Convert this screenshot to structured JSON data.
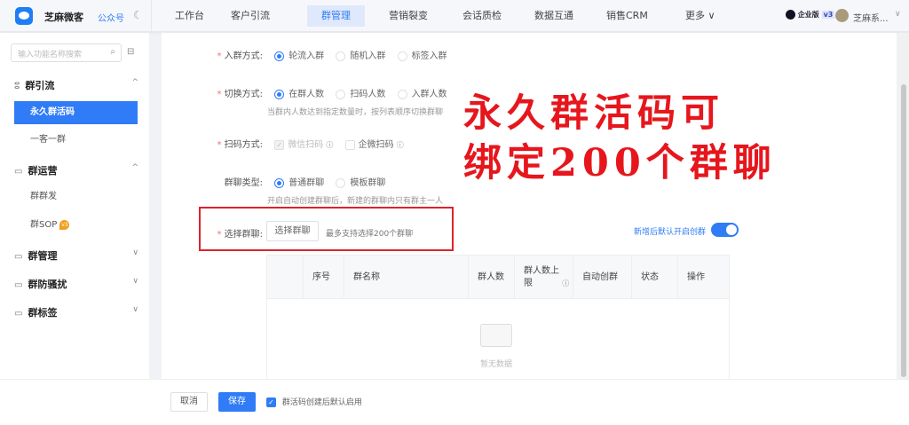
{
  "header": {
    "brand": "芝麻微客",
    "gzh": "公众号",
    "nav": [
      "工作台",
      "客户引流",
      "群管理",
      "营销裂变",
      "会话质检",
      "数据互通",
      "销售CRM",
      "更多 ∨"
    ],
    "active_nav": "群管理",
    "edition": "企业版",
    "version": "v3",
    "user": "芝麻系...",
    "chevron": "∨"
  },
  "sidebar": {
    "search_placeholder": "输入功能名称搜索",
    "groups": [
      {
        "label": "群引流",
        "chev": "^",
        "items": [
          "永久群活码",
          "一客一群"
        ]
      },
      {
        "label": "群运营",
        "chev": "^",
        "items": [
          "群群发",
          "群SOP"
        ]
      },
      {
        "label": "群管理",
        "chev": "∨"
      },
      {
        "label": "群防骚扰",
        "chev": "∨"
      },
      {
        "label": "群标签",
        "chev": "∨"
      }
    ],
    "sop_badge": "v3"
  },
  "form": {
    "join": {
      "label": "入群方式:",
      "options": [
        "轮流入群",
        "随机入群",
        "标签入群"
      ],
      "selected": "轮流入群"
    },
    "switch": {
      "label": "切换方式:",
      "options": [
        "在群人数",
        "扫码人数",
        "入群人数"
      ],
      "selected": "在群人数",
      "hint": "当群内人数达到指定数量时，按列表顺序切换群聊"
    },
    "scan": {
      "label": "扫码方式:",
      "options": [
        "微信扫码",
        "企微扫码"
      ],
      "checked": "微信扫码"
    },
    "type": {
      "label": "群聊类型:",
      "options": [
        "普通群聊",
        "模板群聊"
      ],
      "selected": "普通群聊",
      "hint": "开启自动创建群聊后，新建的群聊内只有群主一人"
    },
    "select": {
      "label": "选择群聊:",
      "button": "选择群聊",
      "hint": "最多支持选择200个群聊"
    },
    "auto_toggle": {
      "label": "新增后默认开启创群",
      "on": true
    }
  },
  "table": {
    "columns": [
      "序号",
      "群名称",
      "群人数",
      "群人数上限",
      "自动创群",
      "状态",
      "操作"
    ],
    "empty": "暂无数据"
  },
  "overlay": [
    "永久群活码可",
    "绑定200个群聊"
  ],
  "footer": {
    "cancel": "取消",
    "save": "保存",
    "checkbox": "群活码创建后默认启用",
    "checked": true
  },
  "colors": {
    "primary": "#2f7cf6",
    "highlight": "#e0222a"
  }
}
